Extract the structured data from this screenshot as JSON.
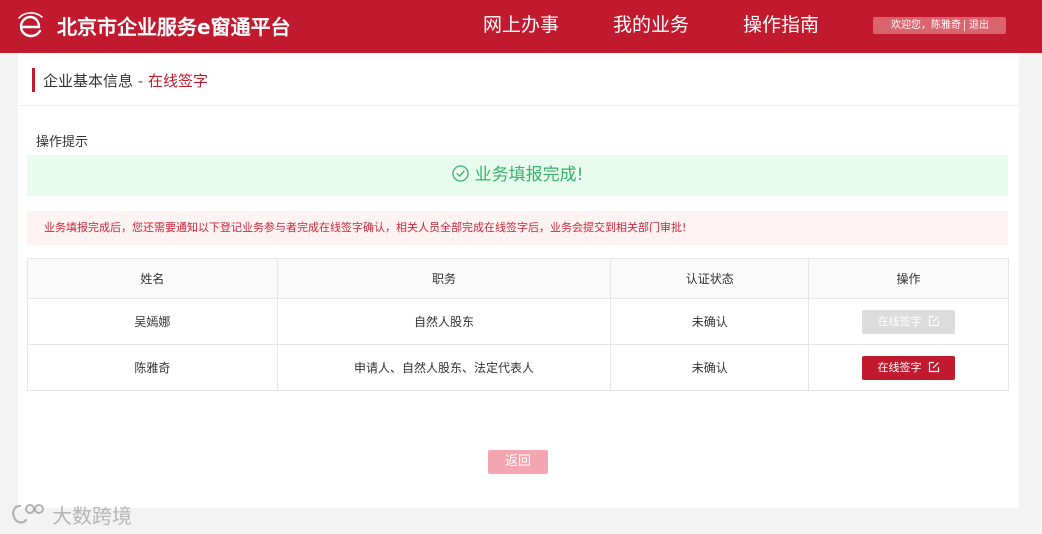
{
  "header": {
    "app_title": "北京市企业服务e窗通平台",
    "nav": [
      {
        "label": "网上办事"
      },
      {
        "label": "我的业务"
      },
      {
        "label": "操作指南"
      }
    ],
    "user": {
      "greeting": "欢迎您，陈雅奇",
      "logout": "退出"
    },
    "brand_color": "#c1192d"
  },
  "breadcrumb": {
    "parent": "企业基本信息",
    "separator": "-",
    "current": "在线签字"
  },
  "tips": {
    "label": "操作提示",
    "success_message": "业务填报完成!",
    "notice": "业务填报完成后，您还需要通知以下登记业务参与者完成在线签字确认，相关人员全部完成在线签字后，业务会提交到相关部门审批!"
  },
  "table": {
    "headers": [
      "姓名",
      "职务",
      "认证状态",
      "操作"
    ],
    "rows": [
      {
        "name": "吴嫣娜",
        "role": "自然人股东",
        "status": "未确认",
        "action": "在线签字",
        "action_enabled": false
      },
      {
        "name": "陈雅奇",
        "role": "申请人、自然人股东、法定代表人",
        "status": "未确认",
        "action": "在线签字",
        "action_enabled": true
      }
    ]
  },
  "back_button": "返回",
  "watermark": {
    "text": "大数跨境",
    "icon": "brand-logo-icon"
  },
  "colors": {
    "success_bg": "#e7fbef",
    "success_text": "#3bb16a",
    "notice_bg": "#fdf3f3",
    "notice_text": "#d0263a"
  }
}
